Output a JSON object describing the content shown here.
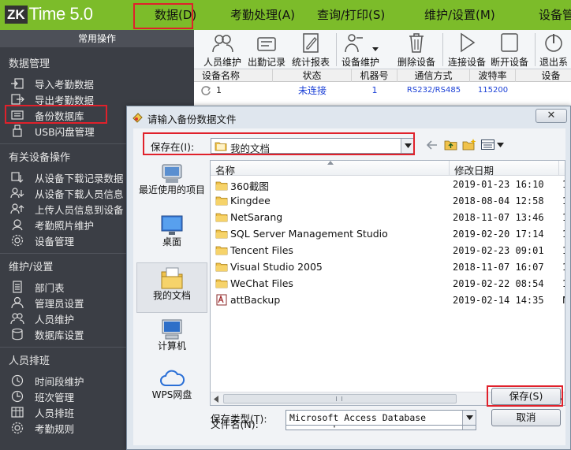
{
  "app": {
    "logo_badge": "ZK",
    "logo_text": "Time 5.0",
    "colors": {
      "top_bar": "#7cbc2a",
      "sidebar_bg": "#3b3e45",
      "highlight": "#e0212b",
      "link_blue": "#1a3fd6"
    }
  },
  "menu": [
    "数据(D)",
    "考勤处理(A)",
    "查询/打印(S)",
    "维护/设置(M)",
    "设备管"
  ],
  "sidebar": {
    "caption": "常用操作",
    "sections": [
      {
        "title": "数据管理",
        "items": [
          {
            "label": "导入考勤数据",
            "icon": "import-icon"
          },
          {
            "label": "导出考勤数据",
            "icon": "export-icon"
          },
          {
            "label": "备份数据库",
            "icon": "backup-icon"
          },
          {
            "label": "USB闪盘管理",
            "icon": "usb-icon"
          }
        ]
      },
      {
        "title": "有关设备操作",
        "items": [
          {
            "label": "从设备下载记录数据",
            "icon": "download-records-icon"
          },
          {
            "label": "从设备下载人员信息",
            "icon": "download-users-icon"
          },
          {
            "label": "上传人员信息到设备",
            "icon": "upload-users-icon"
          },
          {
            "label": "考勤照片维护",
            "icon": "photo-icon"
          },
          {
            "label": "设备管理",
            "icon": "device-gear-icon"
          }
        ]
      },
      {
        "title": "维护/设置",
        "items": [
          {
            "label": "部门表",
            "icon": "department-icon"
          },
          {
            "label": "管理员设置",
            "icon": "admin-icon"
          },
          {
            "label": "人员维护",
            "icon": "users-icon"
          },
          {
            "label": "数据库设置",
            "icon": "database-icon"
          }
        ]
      },
      {
        "title": "人员排班",
        "items": [
          {
            "label": "时间段维护",
            "icon": "time-period-icon"
          },
          {
            "label": "班次管理",
            "icon": "shift-icon"
          },
          {
            "label": "人员排班",
            "icon": "schedule-icon"
          },
          {
            "label": "考勤规则",
            "icon": "rules-icon"
          }
        ]
      }
    ]
  },
  "toolbar": [
    {
      "label": "人员维护",
      "icon": "users-icon"
    },
    {
      "label": "出勤记录",
      "icon": "attendance-icon"
    },
    {
      "label": "统计报表",
      "icon": "report-icon"
    },
    {
      "label": "设备维护",
      "icon": "device-maintain-icon"
    },
    {
      "label": "删除设备",
      "icon": "trash-icon"
    },
    {
      "label": "连接设备",
      "icon": "connect-icon"
    },
    {
      "label": "断开设备",
      "icon": "disconnect-icon"
    },
    {
      "label": "退出系",
      "icon": "power-icon"
    }
  ],
  "device_grid": {
    "columns": [
      "设备名称",
      "状态",
      "机器号",
      "通信方式",
      "波特率",
      "设备"
    ],
    "rows": [
      {
        "name": "1",
        "status": "未连接",
        "number": "1",
        "comm": "RS232/RS485",
        "baud": "115200"
      }
    ]
  },
  "dialog": {
    "title": "请输入备份数据文件",
    "close_label": "✕",
    "save_in_label": "保存在(I):",
    "save_in_value": "我的文档",
    "places": [
      {
        "label": "最近使用的项目",
        "icon": "recent-items-icon"
      },
      {
        "label": "桌面",
        "icon": "desktop-icon"
      },
      {
        "label": "我的文档",
        "icon": "my-documents-icon"
      },
      {
        "label": "计算机",
        "icon": "computer-icon"
      },
      {
        "label": "WPS网盘",
        "icon": "cloud-icon"
      }
    ],
    "columns": {
      "name": "名称",
      "modified": "修改日期"
    },
    "files": [
      {
        "name": "360截图",
        "modified": "2019-01-23 16:10",
        "extra": "1",
        "type": "folder"
      },
      {
        "name": "Kingdee",
        "modified": "2018-08-04 12:58",
        "extra": "1",
        "type": "folder"
      },
      {
        "name": "NetSarang",
        "modified": "2018-11-07 13:46",
        "extra": "1",
        "type": "folder"
      },
      {
        "name": "SQL Server Management Studio",
        "modified": "2019-02-20 17:14",
        "extra": "1",
        "type": "folder"
      },
      {
        "name": "Tencent Files",
        "modified": "2019-02-23 09:01",
        "extra": "1",
        "type": "folder"
      },
      {
        "name": "Visual Studio 2005",
        "modified": "2018-11-07 16:07",
        "extra": "1",
        "type": "folder"
      },
      {
        "name": "WeChat Files",
        "modified": "2019-02-22 08:54",
        "extra": "1",
        "type": "folder"
      },
      {
        "name": "attBackup",
        "modified": "2019-02-14 14:35",
        "extra": "M",
        "type": "access-file"
      }
    ],
    "file_name_label": "文件名(N):",
    "file_name_value": "attBackup",
    "file_type_label": "保存类型(T):",
    "file_type_value": "Microsoft Access Database",
    "save_button": "保存(S)",
    "cancel_button": "取消"
  }
}
